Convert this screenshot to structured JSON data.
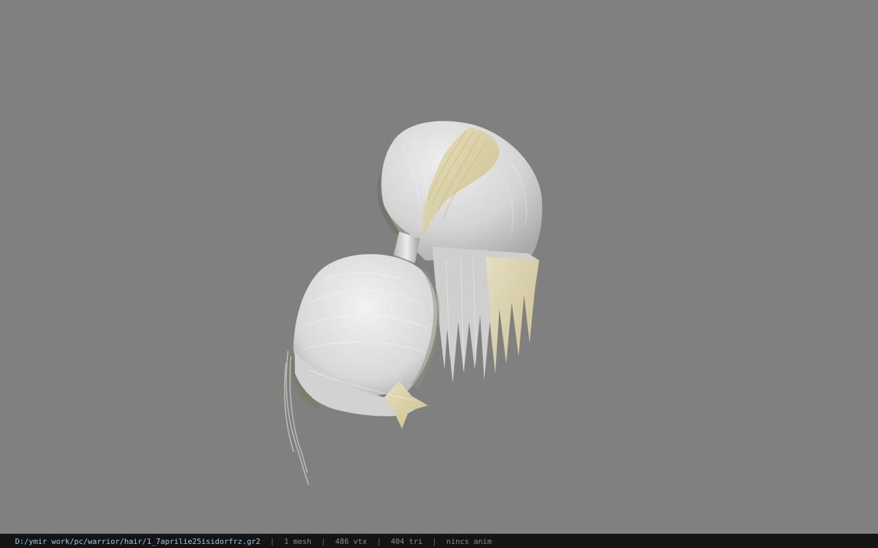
{
  "viewer": {
    "background_color": "#808080",
    "model": {
      "name": "hair-mesh",
      "primary_color": "#d6d6d6",
      "highlight_color": "#d9cfa0"
    }
  },
  "statusbar": {
    "file_path": "D:/ymir work/pc/warrior/hair/1_7aprilie25isidorfrz.gr2",
    "separator": "|",
    "mesh_count": "1 mesh",
    "vertex_count": "486 vtx",
    "triangle_count": "404 tri",
    "anim": "nincs anim"
  }
}
